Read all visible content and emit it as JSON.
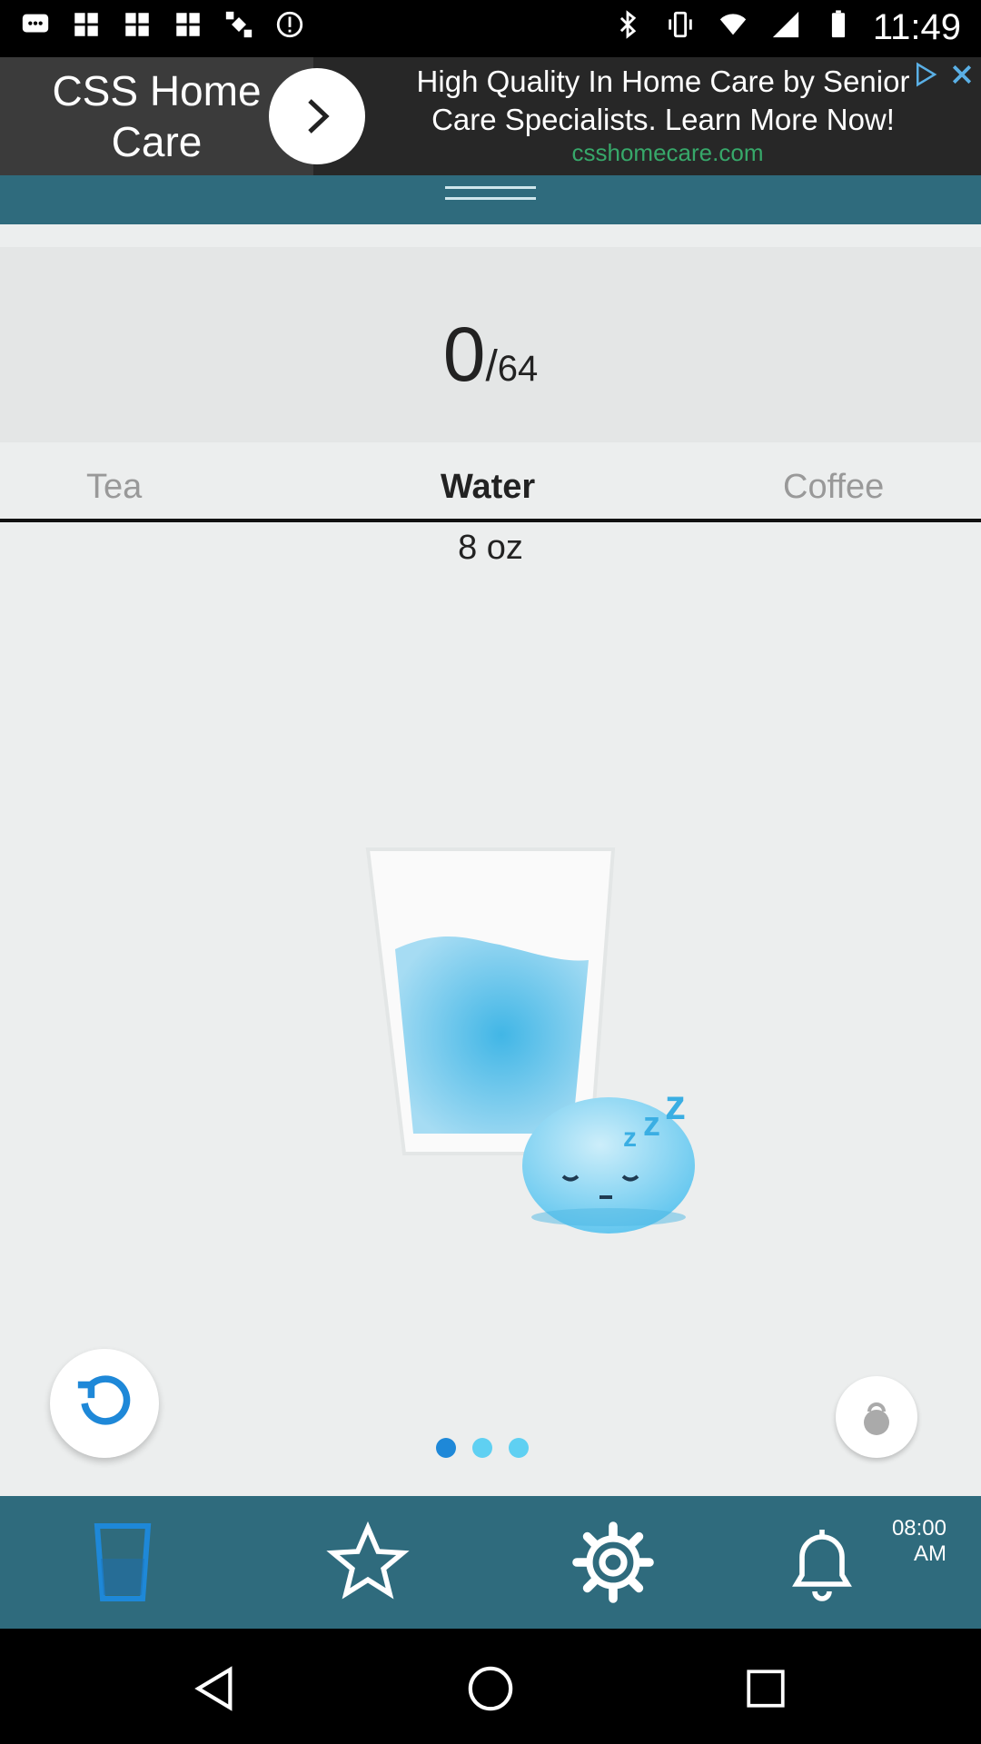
{
  "status_bar": {
    "time": "11:49"
  },
  "ad": {
    "brand": "CSS Home Care",
    "headline": "High Quality In Home Care by Senior Care Specialists. Learn More Now!",
    "url": "csshomecare.com"
  },
  "counter": {
    "current": "0",
    "separator": "/",
    "goal": "64"
  },
  "tabs": [
    {
      "label": "Tea",
      "active": false
    },
    {
      "label": "Water",
      "active": true
    },
    {
      "label": "Coffee",
      "active": false
    }
  ],
  "serving": {
    "amount": "8 oz"
  },
  "pager": {
    "count": 3,
    "active_index": 0
  },
  "bottom_nav": {
    "items": [
      "glass-icon",
      "star-icon",
      "gear-icon",
      "bell-icon"
    ],
    "alarm_time": "08:00",
    "alarm_period": "AM"
  },
  "colors": {
    "accent": "#2f6b7d",
    "water": "#5fc6ee",
    "dot_active": "#1e88d8"
  }
}
